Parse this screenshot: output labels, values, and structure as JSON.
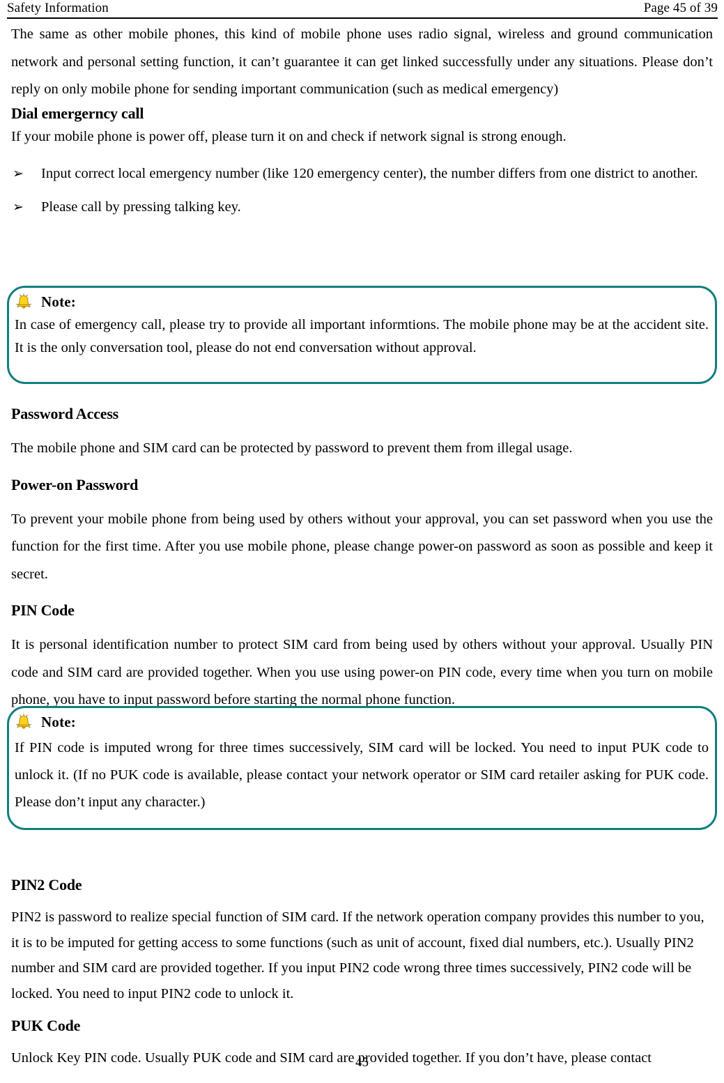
{
  "header": {
    "section_title": "Safety Information",
    "page_indicator": "Page 45 of 39"
  },
  "colors": {
    "note_border": "#107e7d",
    "bell_body": "#ffd21e",
    "bell_shade": "#e8a900",
    "text": "#000000",
    "page_background": "#ffffff"
  },
  "content": {
    "intro_paragraph": "The same as other mobile phones, this kind of mobile phone uses radio signal, wireless and ground communication network and personal setting function, it can’t guarantee it can get linked successfully under any situations. Please don’t reply on only mobile phone for sending important communication (such as medical emergency)",
    "dial_emergency": {
      "heading": "Dial emergerncy call",
      "intro": "If your mobile phone is power off, please turn it on and check if network signal is strong enough.",
      "bullet_glyph": "➢",
      "bullets": [
        "Input correct local emergency number (like 120 emergency center), the number differs from one district to another.",
        "Please call by pressing talking key."
      ]
    },
    "note_1": {
      "icon": "bell-icon",
      "title": "Note:",
      "text": "In case of emergency call, please try to provide all important informtions. The mobile phone may be at the accident site. It is the only conversation tool, please do not end conversation without approval."
    },
    "password_access": {
      "heading": "Password Access",
      "paragraph": "The mobile phone and SIM card can be protected by password to prevent them from illegal usage."
    },
    "power_on_password": {
      "heading": "Power-on Password",
      "paragraph": "To prevent your mobile phone from being used by others without your approval, you can set password when you use the function for the first time. After you use mobile phone, please change power-on password as soon as possible and keep it secret."
    },
    "pin_code": {
      "heading": "PIN Code",
      "paragraph": "It is personal identification number to protect SIM card from being used by others without your approval. Usually PIN code and SIM card are provided together. When you use using power-on PIN code, every time when you turn on mobile phone, you have to input password before starting the normal phone function."
    },
    "note_2": {
      "icon": "bell-icon",
      "title": "Note:",
      "text": "If PIN code is imputed wrong for three times successively, SIM card will be locked. You need to input PUK code to unlock it. (If no PUK code is available, please contact your network operator or SIM card retailer asking for PUK code. Please don’t input any character.)"
    },
    "pin2_code": {
      "heading": "PIN2 Code",
      "paragraph": "PIN2 is password to realize special function of SIM card. If the network operation company provides this number to you, it is to be imputed for getting access to some functions (such as unit of account, fixed dial numbers, etc.). Usually PIN2 number and SIM card are provided together. If you input PIN2 code wrong three times successively, PIN2 code will be locked. You need to input PIN2 code to unlock it."
    },
    "puk_code": {
      "heading": "PUK Code",
      "paragraph": "Unlock Key PIN code. Usually PUK code and SIM card are provided together. If you don’t have, please contact"
    }
  },
  "footer": {
    "page_number": "45"
  }
}
